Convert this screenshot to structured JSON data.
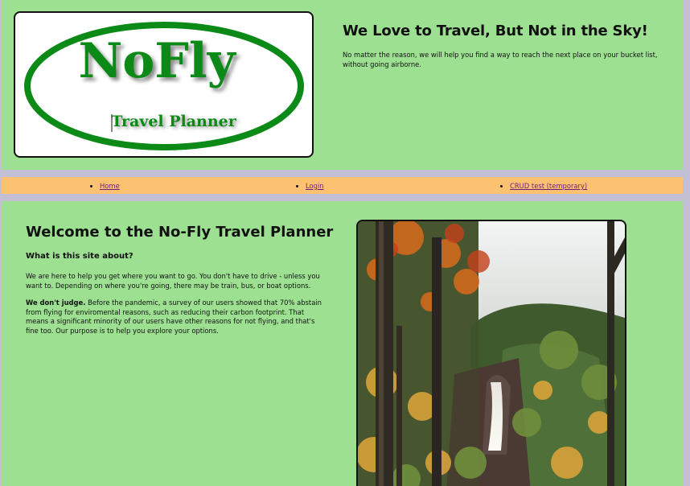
{
  "header": {
    "logo": {
      "wordmark": "NoFly",
      "tagline": "Travel Planner"
    },
    "title": "We Love to Travel, But Not in the Sky!",
    "description": "No matter the reason, we will help you find a way to reach the next place on your bucket list, without going airborne."
  },
  "nav": {
    "items": [
      {
        "label": "Home"
      },
      {
        "label": "Login"
      },
      {
        "label": "CRUD test (temporary)"
      }
    ]
  },
  "main": {
    "title": "Welcome to the No-Fly Travel Planner",
    "subheading": "What is this site about?",
    "paragraph1": "We are here to help you get where you want to go. You don't have to drive - unless you want to. Depending on where you're going, there may be train, bus, or boat options.",
    "paragraph2_lead": "We don't judge.",
    "paragraph2_rest": " Before the pandemic, a survey of our users showed that 70% abstain from flying for enviromental reasons, such as reducing their carbon footprint. That means a significant minority of our users have other reasons for not flying, and that's fine too. Our purpose is to help you explore your options."
  },
  "colors": {
    "page_background": "#c3c0d6",
    "panel_green": "#9de092",
    "nav_orange": "#fcc272",
    "logo_green": "#0b8a17",
    "link": "#6b1f7a"
  }
}
